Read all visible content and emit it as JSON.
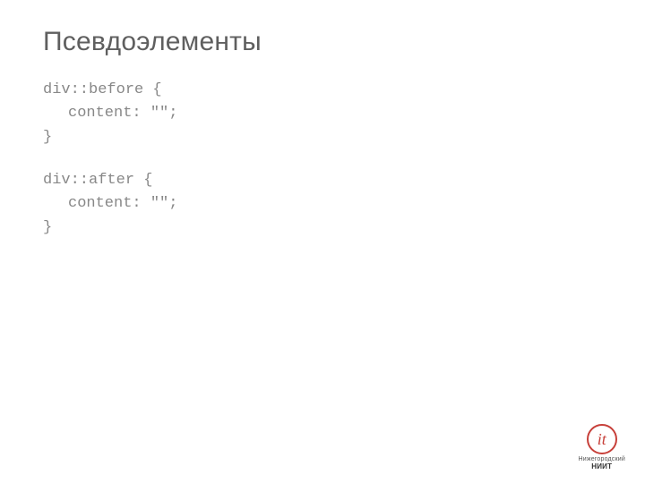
{
  "title": "Псевдоэлементы",
  "code": {
    "block1": {
      "line1": "div::before {",
      "line2": "content: \"\";",
      "line3": "}"
    },
    "block2": {
      "line1": "div::after {",
      "line2": "content: \"\";",
      "line3": "}"
    }
  },
  "logo": {
    "mark": "it",
    "line1": "Нижегородский",
    "line2": "НИИТ"
  }
}
